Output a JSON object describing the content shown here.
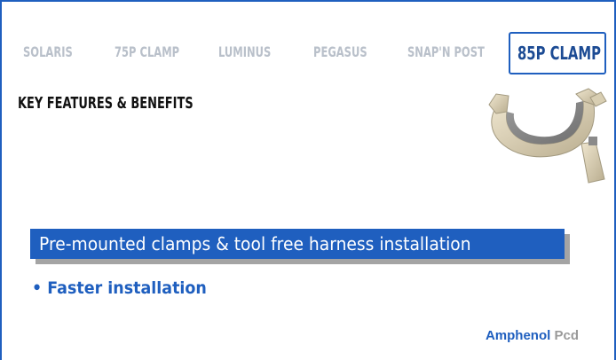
{
  "tabs": [
    {
      "label": "SOLARIS",
      "active": false
    },
    {
      "label": "75P CLAMP",
      "active": false
    },
    {
      "label": "LUMINUS",
      "active": false
    },
    {
      "label": "PEGASUS",
      "active": false
    },
    {
      "label": "SNAP'N POST",
      "active": false
    },
    {
      "label": "85P CLAMP",
      "active": true
    }
  ],
  "heading": "KEY FEATURES & BENEFITS",
  "banner": "Pre-mounted clamps & tool free harness installation",
  "bullet": "• Faster installation",
  "logo": {
    "brand": "Amphenol",
    "suffix": "Pcd"
  },
  "colors": {
    "accent": "#1f5fbf",
    "inactive_tab": "#b9c0ca",
    "active_tab_text": "#1c4b94"
  }
}
